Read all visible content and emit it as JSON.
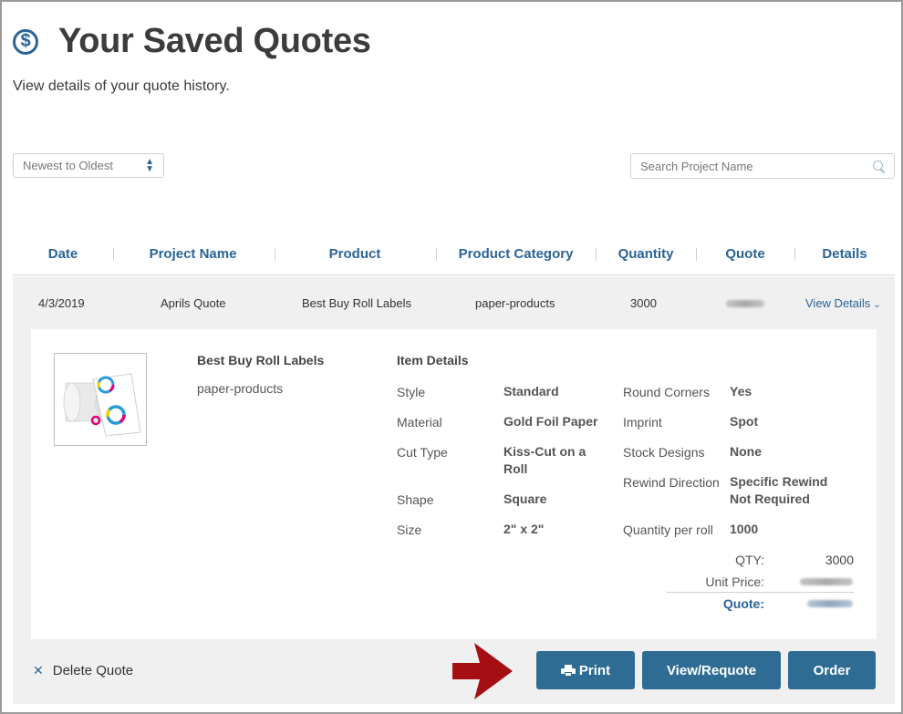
{
  "header": {
    "title": "Your Saved Quotes",
    "subtitle": "View details of your quote history.",
    "icon": "dollar-circle-icon"
  },
  "controls": {
    "sort_selected": "Newest to Oldest",
    "search_placeholder": "Search Project Name"
  },
  "table": {
    "columns": [
      "Date",
      "Project Name",
      "Product",
      "Product Category",
      "Quantity",
      "Quote",
      "Details"
    ],
    "row": {
      "date": "4/3/2019",
      "project_name": "Aprils Quote",
      "product": "Best Buy Roll Labels",
      "category": "paper-products",
      "quantity": "3000",
      "view_details": "View Details"
    }
  },
  "details": {
    "product_name": "Best Buy Roll Labels",
    "product_category": "paper-products",
    "heading": "Item Details",
    "left": [
      {
        "label": "Style",
        "value": "Standard"
      },
      {
        "label": "Material",
        "value": "Gold Foil Paper"
      },
      {
        "label": "Cut Type",
        "value": "Kiss-Cut on a Roll"
      },
      {
        "label": "Shape",
        "value": "Square"
      },
      {
        "label": "Size",
        "value": "2\" x 2\""
      }
    ],
    "right": [
      {
        "label": "Round Corners",
        "value": "Yes"
      },
      {
        "label": "Imprint",
        "value": "Spot"
      },
      {
        "label": "Stock Designs",
        "value": "None"
      },
      {
        "label": "Rewind Direction",
        "value": "Specific Rewind Not Required"
      },
      {
        "label": "Quantity per roll",
        "value": "1000"
      }
    ],
    "totals": {
      "qty_label": "QTY:",
      "qty_value": "3000",
      "unit_price_label": "Unit Price:",
      "quote_label": "Quote:"
    }
  },
  "actions": {
    "delete": "Delete Quote",
    "print": "Print",
    "requote": "View/Requote",
    "order": "Order"
  },
  "colors": {
    "accent": "#2a6496",
    "button": "#2e6c94",
    "arrow": "#a50f14"
  }
}
